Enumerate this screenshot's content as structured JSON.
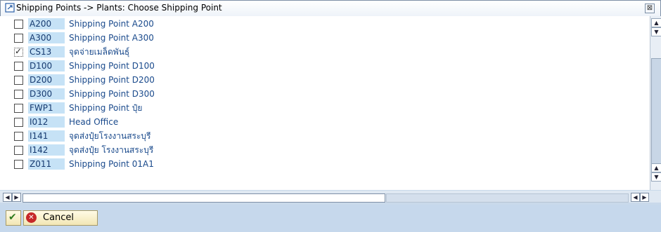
{
  "window": {
    "title": "Shipping Points -> Plants: Choose Shipping Point",
    "close_glyph": "⊠"
  },
  "list": {
    "rows": [
      {
        "code": "A200",
        "description": "Shipping Point A200",
        "checked": false
      },
      {
        "code": "A300",
        "description": "Shipping Point A300",
        "checked": false
      },
      {
        "code": "CS13",
        "description": "จุดจ่ายเมล็ดพันธุ์",
        "checked": true
      },
      {
        "code": "D100",
        "description": "Shipping Point D100",
        "checked": false
      },
      {
        "code": "D200",
        "description": "Shipping Point D200",
        "checked": false
      },
      {
        "code": "D300",
        "description": "Shipping Point D300",
        "checked": false
      },
      {
        "code": "FWP1",
        "description": "Shipping Point ปุ๋ย",
        "checked": false
      },
      {
        "code": "I012",
        "description": "Head Office",
        "checked": false
      },
      {
        "code": "I141",
        "description": "จุดส่งปุ๋ยโรงงานสระบุรี",
        "checked": false
      },
      {
        "code": "I142",
        "description": "จุดส่งปุ๋ย โรงงานสระบุรี",
        "checked": false
      },
      {
        "code": "Z011",
        "description": "Shipping Point 01A1",
        "checked": false
      }
    ]
  },
  "buttons": {
    "ok_icon": "check-icon",
    "cancel_label": "Cancel"
  },
  "colors": {
    "code_highlight": "#c6e2f6",
    "description_text": "#1a4a8c",
    "button_bar": "#c6d8ec"
  }
}
